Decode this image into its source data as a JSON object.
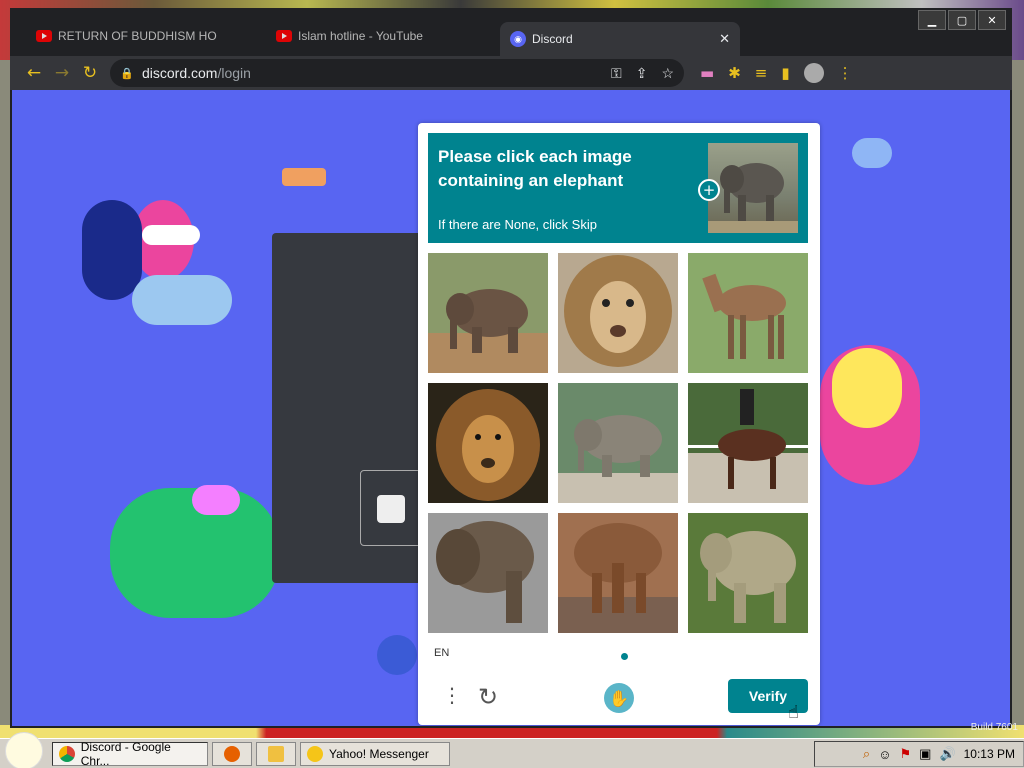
{
  "browser": {
    "tabs": [
      {
        "label": "RETURN OF BUDDHISM HO",
        "icon": "youtube-icon",
        "active": false
      },
      {
        "label": "Islam hotline - YouTube",
        "icon": "youtube-icon",
        "active": false
      },
      {
        "label": "Discord",
        "icon": "discord-icon",
        "active": true
      }
    ],
    "tab_close": "✕",
    "win": {
      "min": "▁",
      "max": "▢",
      "close": "✕"
    },
    "url_host": "discord.com",
    "url_path": "/login",
    "nav": {
      "back": "←",
      "forward": "→",
      "reload": "↻"
    }
  },
  "captcha": {
    "title": "Please click each image containing an elephant",
    "subtitle": "If there are None, click Skip",
    "language": "EN",
    "verify_label": "Verify",
    "menu_glyph": "⋮",
    "refresh_glyph": "↻",
    "plus_glyph": "+",
    "images": [
      {
        "subject": "elephant"
      },
      {
        "subject": "lion"
      },
      {
        "subject": "horse"
      },
      {
        "subject": "lion"
      },
      {
        "subject": "elephant"
      },
      {
        "subject": "horse"
      },
      {
        "subject": "elephant"
      },
      {
        "subject": "elephant"
      },
      {
        "subject": "elephant"
      }
    ],
    "accent_color": "#00838f"
  },
  "taskbar": {
    "items": [
      {
        "label": "Discord - Google Chr...",
        "icon": "chrome-icon",
        "active": true
      },
      {
        "label": "",
        "icon": "firefox-icon",
        "active": false
      },
      {
        "label": "",
        "icon": "folder-icon",
        "active": false
      },
      {
        "label": "Yahoo! Messenger",
        "icon": "yahoo-messenger-icon",
        "active": false
      }
    ],
    "clock": "10:13 PM"
  },
  "desktop": {
    "build_text": "Build 7601"
  },
  "colors": {
    "discord_bg": "#5865f2",
    "chrome_dark": "#35363a",
    "toolbar_icon": "#e8c020"
  }
}
